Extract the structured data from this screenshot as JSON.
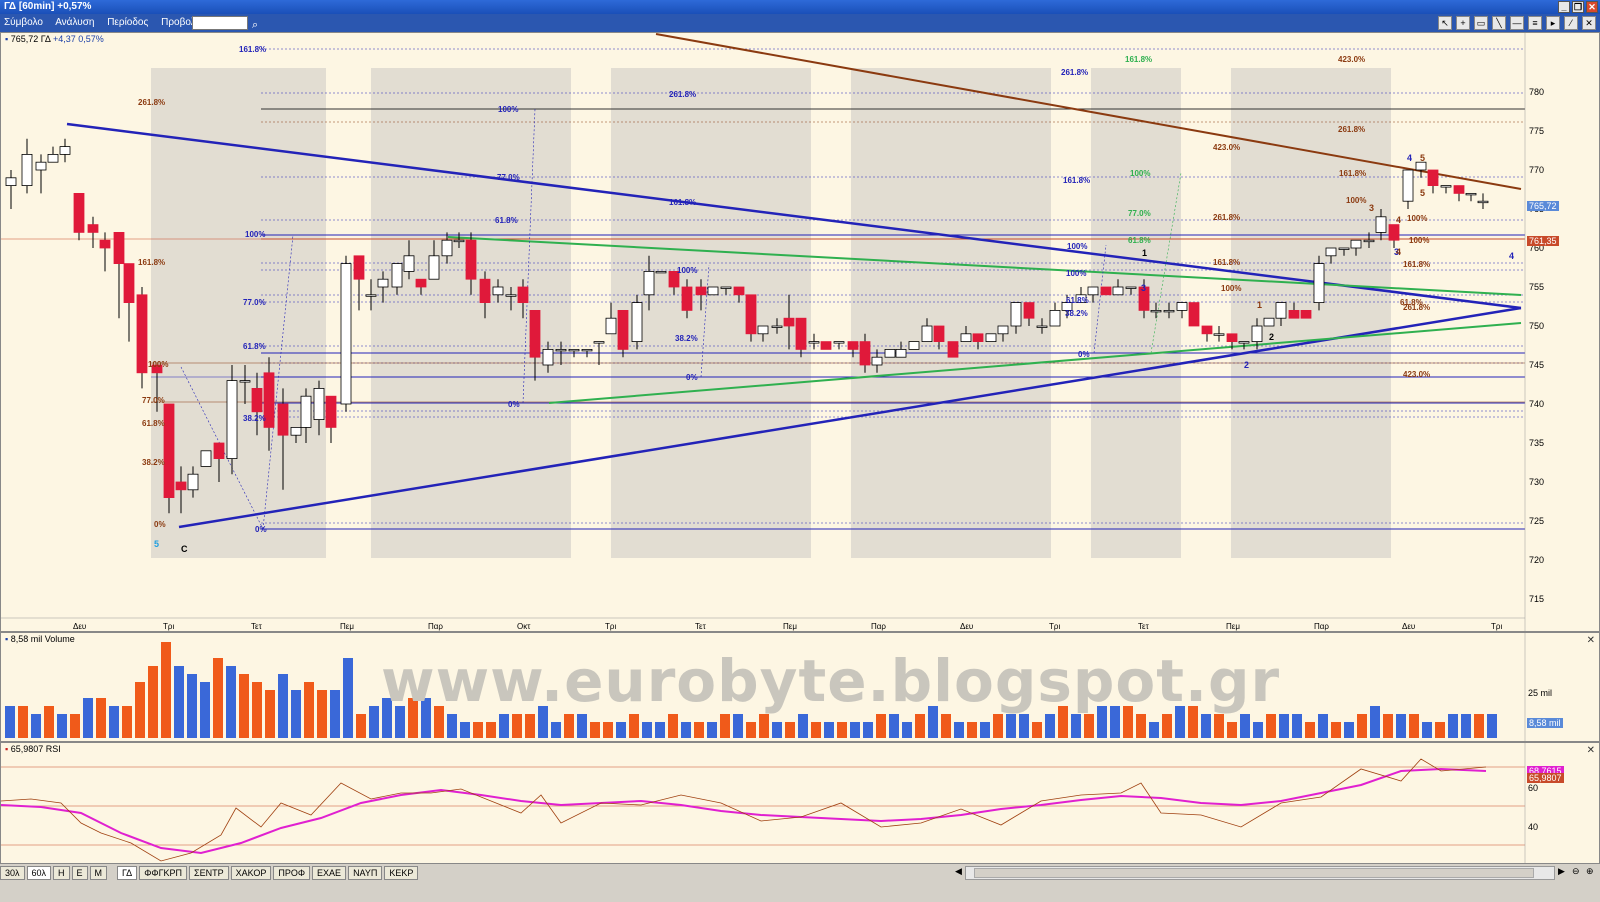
{
  "window": {
    "title": "ΓΔ [60min] +0,57%"
  },
  "menu": {
    "items": [
      "Σύμβολο",
      "Ανάλυση",
      "Περίοδος",
      "Προβολή"
    ]
  },
  "price_panel": {
    "header_value": "765,72",
    "header_symbol": "ΓΔ",
    "header_change": "+4,37 0,57%",
    "last_price_tag": "765,72",
    "secondary_tag": "761,35",
    "y_ticks": [
      "780",
      "775",
      "770",
      "765",
      "760",
      "755",
      "750",
      "745",
      "740",
      "735",
      "730",
      "725",
      "720",
      "715"
    ],
    "x_ticks": [
      "Δευ",
      "Τρι",
      "Τετ",
      "Πεμ",
      "Παρ",
      "Οκτ",
      "Τρι",
      "Τετ",
      "Πεμ",
      "Παρ",
      "Δευ",
      "Τρι",
      "Τετ",
      "Πεμ",
      "Παρ",
      "Δευ",
      "Τρι"
    ],
    "watermark": "www.eurobyte.blogspot.gr",
    "wave_labels": [
      "5",
      "C",
      "1",
      "2",
      "3",
      "4",
      "5",
      "3",
      "4",
      "1",
      "2",
      "4",
      "3",
      "5",
      "4"
    ],
    "fib_labels": [
      "161.8%",
      "261.8%",
      "100%",
      "77.0%",
      "61.8%",
      "38.2%",
      "0%",
      "423.0%"
    ]
  },
  "volume_panel": {
    "label": "8,58 mil Volume",
    "tick": "25 mil",
    "last_tag": "8,58 mil"
  },
  "rsi_panel": {
    "label": "65,9807 RSI",
    "ticks": [
      "60",
      "40"
    ],
    "tag1": "68,7615",
    "tag2": "65,9807"
  },
  "bottom": {
    "period_tabs": [
      "30λ",
      "60λ",
      "Η",
      "Ε",
      "Μ"
    ],
    "symbol_tabs": [
      "ΓΔ",
      "ΦΦΓΚΡΠ",
      "ΣΕΝΤΡ",
      "ΧΑΚΟΡ",
      "ΠΡΟΦ",
      "ΕΧΑΕ",
      "ΝΑΥΠ",
      "ΚΕΚΡ"
    ]
  },
  "colors": {
    "up": "#ffffff",
    "down": "#e0193a",
    "blue_line": "#2323b8",
    "green_line": "#2fb04f",
    "brown_line": "#8b3a10",
    "vol_blue": "#3a68d8",
    "vol_orange": "#f05a1a",
    "rsi": "#e020d0",
    "rsi_line": "#a04010"
  }
}
